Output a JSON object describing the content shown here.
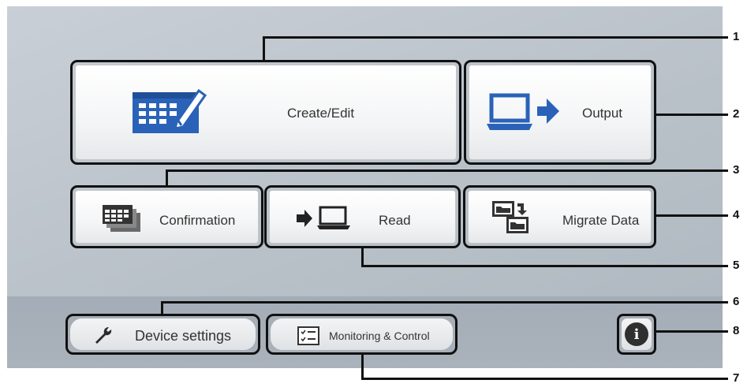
{
  "tiles": {
    "create_edit": {
      "label": "Create/Edit"
    },
    "output": {
      "label": "Output"
    },
    "confirmation": {
      "label": "Confirmation"
    },
    "read": {
      "label": "Read"
    },
    "migrate_data": {
      "label": "Migrate Data"
    }
  },
  "bottom": {
    "device_settings": {
      "label": "Device settings"
    },
    "monitoring_control": {
      "label": "Monitoring & Control"
    },
    "info": {
      "label": "i"
    }
  },
  "callouts": [
    "1",
    "2",
    "3",
    "4",
    "5",
    "6",
    "7",
    "8"
  ],
  "colors": {
    "icon_blue": "#2a62b8",
    "outline": "#111111",
    "label_text": "#333333"
  },
  "icons": {
    "create_edit": "calendar-edit-icon",
    "output": "laptop-arrow-out-icon",
    "confirmation": "stacked-calendars-icon",
    "read": "arrow-into-laptop-icon",
    "migrate_data": "folder-transfer-icon",
    "device_settings": "wrench-icon",
    "monitoring_control": "checklist-icon",
    "info": "info-icon"
  }
}
